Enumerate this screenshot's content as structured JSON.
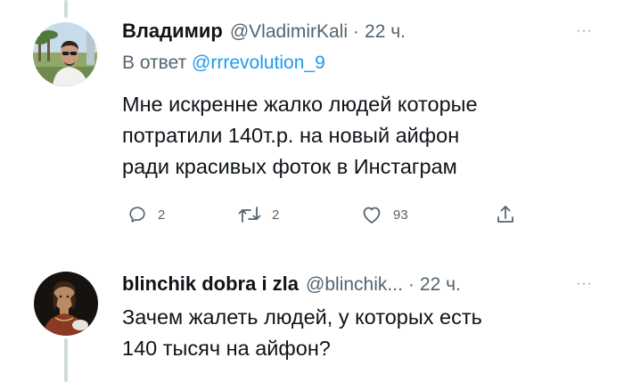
{
  "tweets": [
    {
      "author_name": "Владимир",
      "handle": "@VladimirKali",
      "separator": "·",
      "time": "22 ч.",
      "more_icon": "more-horizontal-icon",
      "reply_prefix": "В ответ",
      "reply_to": "@rrrevolution_9",
      "text_lines": [
        "Мне искренне жалко людей которые",
        "потратили 140т.р. на новый айфон",
        "ради красивых фоток в Инстаграм"
      ],
      "actions": {
        "reply": {
          "icon": "reply-icon",
          "count": "2"
        },
        "retweet": {
          "icon": "retweet-icon",
          "count": "2"
        },
        "like": {
          "icon": "heart-icon",
          "count": "93"
        },
        "share": {
          "icon": "share-icon"
        }
      }
    },
    {
      "author_name": "blinchik dobra i zla",
      "handle": "@blinchik...",
      "separator": "·",
      "time": "22 ч.",
      "more_icon": "more-horizontal-icon",
      "text_lines": [
        "Зачем жалеть людей, у которых есть",
        "140 тысяч на айфон?"
      ]
    }
  ],
  "colors": {
    "text": "#0f1419",
    "secondary": "#536471",
    "link": "#1d9bf0",
    "thread_line": "#cfd9de"
  }
}
